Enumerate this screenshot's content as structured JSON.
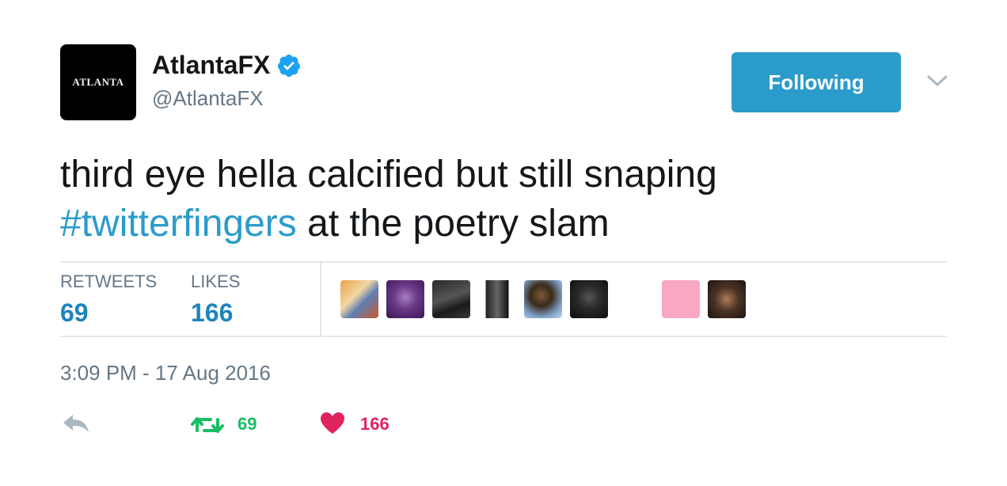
{
  "account": {
    "avatar_text": "ATLANTA",
    "display_name": "AtlantaFX",
    "handle": "@AtlantaFX",
    "verified": true
  },
  "follow_button": {
    "label": "Following"
  },
  "tweet": {
    "text_line1": "third eye hella calcified but still snaping",
    "hashtag": "#twitterfingers",
    "text_line2_rest": " at the poetry slam"
  },
  "stats": {
    "retweets_label": "RETWEETS",
    "retweets_value": "69",
    "likes_label": "LIKES",
    "likes_value": "166"
  },
  "timestamp": "3:09 PM - 17 Aug 2016",
  "actions": {
    "retweet_count": "69",
    "like_count": "166"
  },
  "colors": {
    "brand_blue": "#2b9bcb",
    "retweet_green": "#17bf63",
    "like_red": "#e0245e",
    "secondary_text": "#657786"
  }
}
